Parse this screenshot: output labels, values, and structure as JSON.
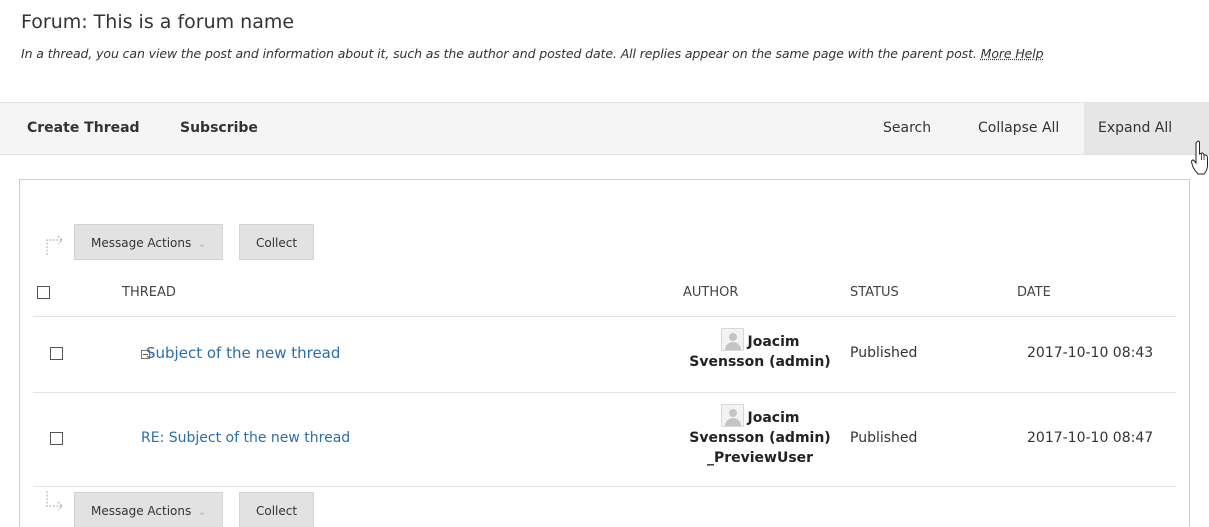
{
  "forum": {
    "title": "Forum: This is a forum name",
    "description": "In a thread, you can view the post and information about it, such as the author and posted date. All replies appear on the same page with the parent post.",
    "help_link": "More Help"
  },
  "toolbar": {
    "create_thread": "Create Thread",
    "subscribe": "Subscribe",
    "search": "Search",
    "collapse_all": "Collapse All",
    "expand_all": "Expand All"
  },
  "actions": {
    "message_actions": "Message Actions",
    "collect": "Collect"
  },
  "table": {
    "headers": {
      "thread": "THREAD",
      "author": "AUTHOR",
      "status": "STATUS",
      "date": "DATE"
    },
    "rows": [
      {
        "thread": "Subject of the new thread",
        "author_line1": "Joacim",
        "author_line2": "Svensson (admin)",
        "author_line3": "",
        "status": "Published",
        "date": "2017-10-10 08:43"
      },
      {
        "thread": "RE: Subject of the new thread",
        "author_line1": "Joacim",
        "author_line2": "Svensson (admin)",
        "author_line3": "_PreviewUser",
        "status": "Published",
        "date": "2017-10-10 08:47"
      }
    ]
  },
  "colors": {
    "link": "#2a6ea8",
    "toolbar_bg": "#f5f5f5",
    "button_bg": "#e2e2e2"
  }
}
